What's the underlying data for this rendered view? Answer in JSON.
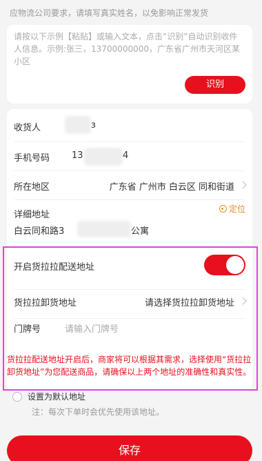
{
  "notice": "应物流公司要求，请填写真实姓名，以免影响正常发货",
  "paste": {
    "hint": "请按以下示例【粘贴】或输入文本，点击“识别”自动识别收件人信息。示例:张三，13700000000，广东省广州市天河区某小区",
    "recognize_label": "识别"
  },
  "form": {
    "recipient_label": "收货人",
    "recipient_value_tail": "з",
    "phone_label": "手机号码",
    "phone_prefix": "13",
    "phone_suffix": "4",
    "region_label": "所在地区",
    "region_value": "广东省 广州市 白云区 同和街道",
    "detail_label": "详细地址",
    "locate_label": "定位",
    "detail_prefix": "白云同和路3",
    "detail_suffix": "公寓"
  },
  "huolala": {
    "enable_label": "开启货拉拉配送地址",
    "enabled": true,
    "unload_label": "货拉拉卸货地址",
    "unload_value": "请选择货拉拉卸货地址",
    "door_label": "门牌号",
    "door_placeholder": "请输入门牌号",
    "warning": "货拉拉配送地址开启后，商家将可以根据其需求，选择使用“货拉拉卸货地址”为您配送商品，请确保以上两个地址的准确性和真实性。"
  },
  "default": {
    "label": "设置为默认地址",
    "note": "注：每次下单时会优先使用该地址。"
  },
  "save_label": "保存",
  "colors": {
    "accent": "#e8101e",
    "locate": "#f08a24",
    "highlight": "#e040e0"
  }
}
